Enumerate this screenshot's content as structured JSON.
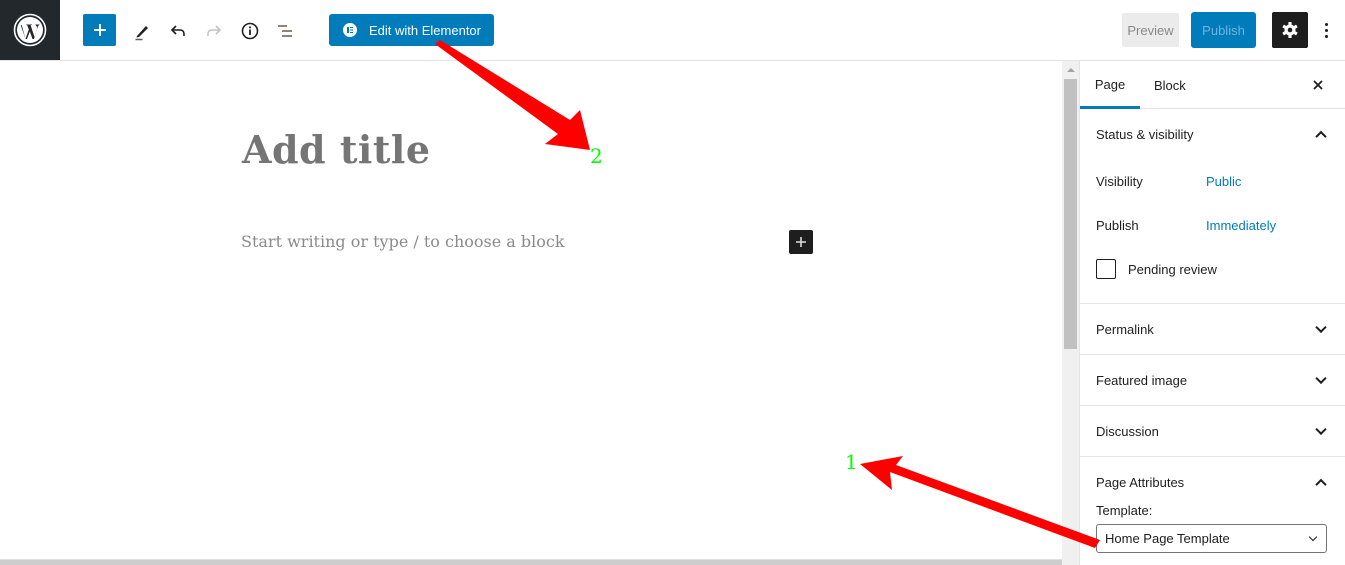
{
  "toolbar": {
    "logo": "wordpress-logo",
    "icons": {
      "add": "plus-icon",
      "tools": "pencil-icon",
      "undo": "undo-icon",
      "redo": "redo-icon",
      "details": "info-icon",
      "outline": "list-view-icon"
    },
    "elementor_label": "Edit with Elementor",
    "preview_label": "Preview",
    "publish_label": "Publish",
    "settings_icon": "gear-icon",
    "more_icon": "vertical-ellipsis-icon"
  },
  "editor": {
    "title_placeholder": "Add title",
    "body_placeholder": "Start writing or type / to choose a block"
  },
  "sidebar": {
    "tabs": [
      {
        "label": "Page",
        "active": true
      },
      {
        "label": "Block",
        "active": false
      }
    ],
    "panels": {
      "status": {
        "title": "Status & visibility",
        "expanded": true,
        "visibility_label": "Visibility",
        "visibility_value": "Public",
        "publish_label": "Publish",
        "publish_value": "Immediately",
        "pending_label": "Pending review",
        "pending_checked": false
      },
      "permalink": {
        "title": "Permalink",
        "expanded": false
      },
      "featured": {
        "title": "Featured image",
        "expanded": false
      },
      "discussion": {
        "title": "Discussion",
        "expanded": false
      },
      "attributes": {
        "title": "Page Attributes",
        "expanded": true,
        "template_label": "Template:",
        "template_value": "Home Page Template"
      }
    }
  },
  "annotations": {
    "label_1": "1",
    "label_2": "2",
    "arrow_color": "#ff0000",
    "label_color": "#00ff00"
  },
  "colors": {
    "accent": "#007cba",
    "dark": "#1e1e1e",
    "logo_bg": "#23282d"
  }
}
